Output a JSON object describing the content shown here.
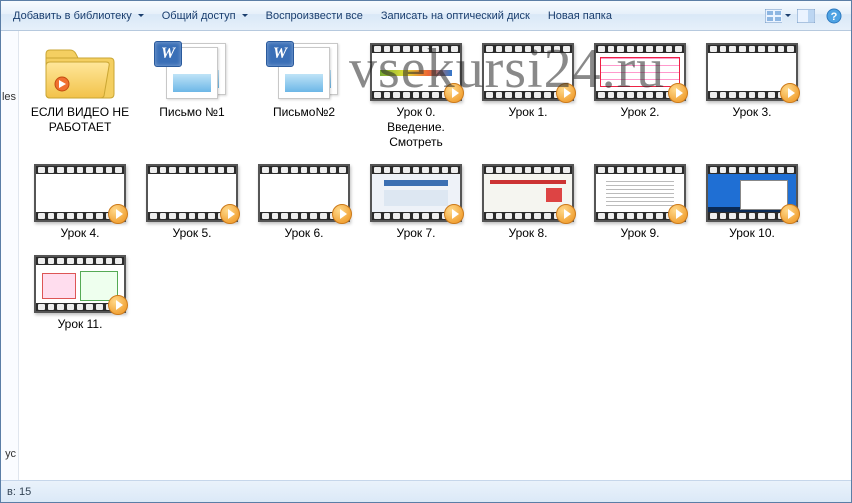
{
  "toolbar": {
    "add_library": "Добавить в библиотеку",
    "share": "Общий доступ",
    "play_all": "Воспроизвести все",
    "burn": "Записать на оптический диск",
    "new_folder": "Новая папка"
  },
  "watermark": "vsekursi24.ru",
  "sidebar": {
    "frag1": "les",
    "frag2": "ус"
  },
  "statusbar": {
    "count_label": "в: 15"
  },
  "items": [
    {
      "type": "folder",
      "label": "ЕСЛИ ВИДЕО НЕ РАБОТАЕТ"
    },
    {
      "type": "word",
      "label": "Письмо №1"
    },
    {
      "type": "word",
      "label": "Письмо№2"
    },
    {
      "type": "video",
      "label": "Урок 0. Введение. Смотреть",
      "body": "vb-multi"
    },
    {
      "type": "video",
      "label": "Урок 1.",
      "body": "vb-white"
    },
    {
      "type": "video",
      "label": "Урок 2.",
      "body": "vb-red-diag"
    },
    {
      "type": "video",
      "label": "Урок 3.",
      "body": "vb-white"
    },
    {
      "type": "video",
      "label": "Урок 4.",
      "body": "vb-white"
    },
    {
      "type": "video",
      "label": "Урок 5.",
      "body": "vb-white"
    },
    {
      "type": "video",
      "label": "Урок 6.",
      "body": "vb-white"
    },
    {
      "type": "video",
      "label": "Урок 7.",
      "body": "vb-site1"
    },
    {
      "type": "video",
      "label": "Урок 8.",
      "body": "vb-site2"
    },
    {
      "type": "video",
      "label": "Урок 9.",
      "body": "vb-doc"
    },
    {
      "type": "video",
      "label": "Урок 10.",
      "body": "vb-desktop"
    },
    {
      "type": "video",
      "label": "Урок 11.",
      "body": "vb-flow"
    }
  ]
}
